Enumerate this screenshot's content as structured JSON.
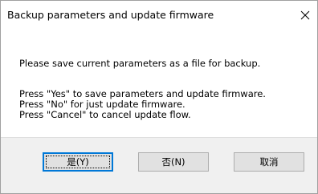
{
  "dialog": {
    "title": "Backup parameters and update firmware",
    "close_icon": "close-icon",
    "message_line1": "Please save current parameters as a file for backup.",
    "message_line2": "Press \"Yes\" to save parameters and update firmware.",
    "message_line3": "Press \"No\" for just update firmware.",
    "message_line4": "Press \"Cancel\" to cancel update flow.",
    "buttons": {
      "yes_label": "是(Y)",
      "no_label": "否(N)",
      "cancel_label": "取消"
    }
  }
}
